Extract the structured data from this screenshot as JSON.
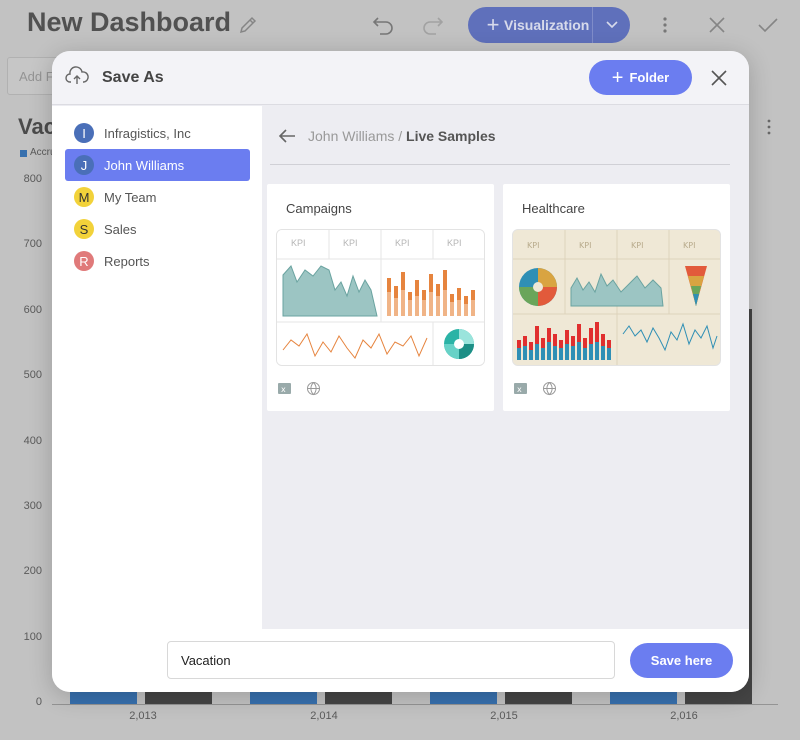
{
  "background": {
    "dashboard_title": "New Dashboard",
    "visualization_button_label": "Visualization",
    "filter_placeholder": "Add Filter",
    "widget_title": "Vacation",
    "legend_label": "Accrued",
    "y_ticks": [
      "800",
      "700",
      "600",
      "500",
      "400",
      "300",
      "200",
      "100",
      "0"
    ],
    "x_ticks": [
      "2,013",
      "2,014",
      "2,015",
      "2,016"
    ],
    "colors": {
      "series_blue": "#2c6fb8",
      "series_dark": "#3d3d3d",
      "accent": "#5b6fc7"
    }
  },
  "modal": {
    "title": "Save As",
    "folder_button_label": "Folder",
    "sidebar": [
      {
        "initial": "I",
        "label": "Infragistics, Inc",
        "color": "#4a6fb8",
        "text_color": "#ffffff"
      },
      {
        "initial": "J",
        "label": "John Williams",
        "color": "#4a6fb8",
        "text_color": "#ffffff",
        "active": true
      },
      {
        "initial": "M",
        "label": "My Team",
        "color": "#f2d23a",
        "text_color": "#333333"
      },
      {
        "initial": "S",
        "label": "Sales",
        "color": "#f2d23a",
        "text_color": "#333333"
      },
      {
        "initial": "R",
        "label": "Reports",
        "color": "#e07a7a",
        "text_color": "#ffffff"
      }
    ],
    "breadcrumb": {
      "parent": "John Williams",
      "separator": "/",
      "current": "Live Samples"
    },
    "cards": [
      {
        "title": "Campaigns",
        "kpi_labels": [
          "KPI",
          "KPI",
          "KPI",
          "KPI"
        ],
        "icons": [
          "excel-icon",
          "web-icon"
        ]
      },
      {
        "title": "Healthcare",
        "kpi_labels": [
          "KPI",
          "KPI",
          "KPI",
          "KPI"
        ],
        "icons": [
          "excel-icon",
          "web-icon"
        ]
      }
    ],
    "name_input_value": "Vacation",
    "save_button_label": "Save here",
    "accent_color": "#6b7df0"
  }
}
